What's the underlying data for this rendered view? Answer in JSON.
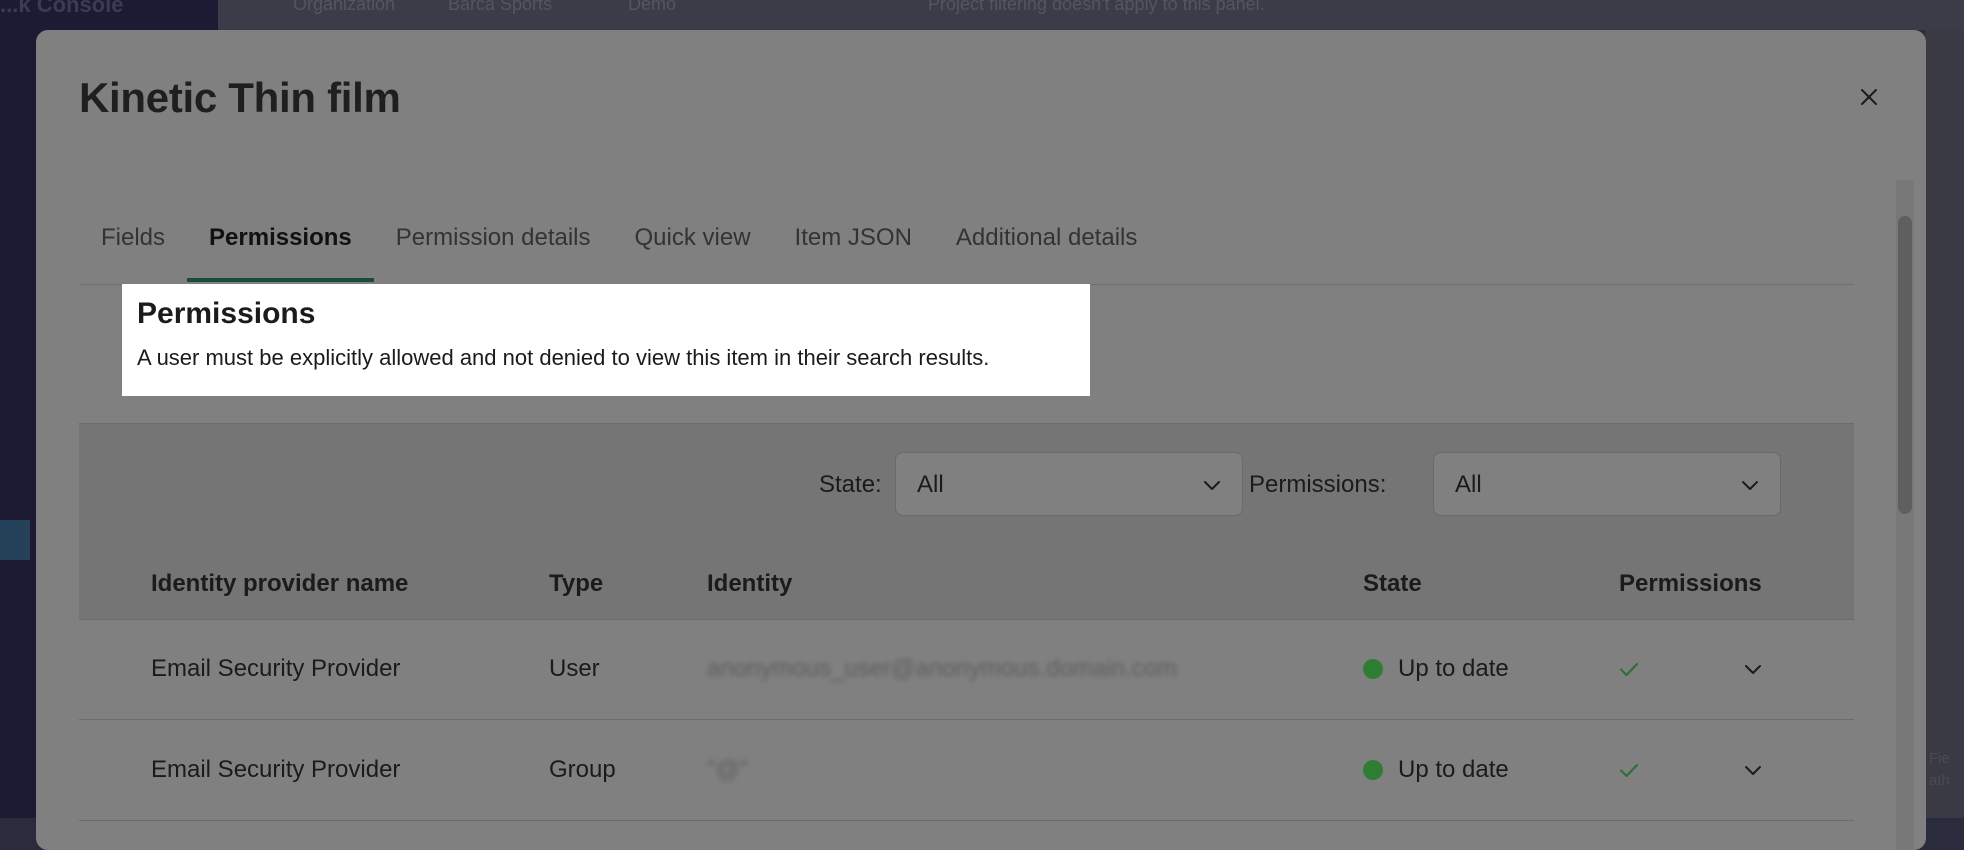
{
  "background": {
    "sidebar_brand": "...k Console",
    "topbar": {
      "organization": "Organization",
      "org_value": "Barca Sports",
      "env": "Demo",
      "notice": "Project filtering doesn't apply to this panel."
    },
    "right_fragments": [
      "Fie",
      "ath"
    ]
  },
  "modal": {
    "title": "Kinetic Thin film",
    "close_icon": "close-icon",
    "tabs": [
      {
        "label": "Fields",
        "active": false
      },
      {
        "label": "Permissions",
        "active": true
      },
      {
        "label": "Permission details",
        "active": false
      },
      {
        "label": "Quick view",
        "active": false
      },
      {
        "label": "Item JSON",
        "active": false
      },
      {
        "label": "Additional details",
        "active": false
      }
    ],
    "info": {
      "heading": "Permissions",
      "text": "A user must be explicitly allowed and not denied to view this item in their search results."
    },
    "filters": {
      "state_label": "State:",
      "state_value": "All",
      "permissions_label": "Permissions:",
      "permissions_value": "All"
    },
    "table": {
      "columns": [
        "Identity provider name",
        "Type",
        "Identity",
        "State",
        "Permissions"
      ],
      "rows": [
        {
          "provider": "Email Security Provider",
          "type": "User",
          "identity": "anonymous_user@anonymous.domain.com",
          "state": "Up to date",
          "permission_icon": "check-icon"
        },
        {
          "provider": "Email Security Provider",
          "type": "Group",
          "identity": "\"@\"",
          "state": "Up to date",
          "permission_icon": "check-icon"
        }
      ]
    }
  },
  "colors": {
    "overlay_modal": "#808080",
    "status_green": "#2e7d32",
    "check_green": "#2c6e35",
    "active_tab_underline": "#1c4a3e",
    "info_background": "#ffffff"
  }
}
